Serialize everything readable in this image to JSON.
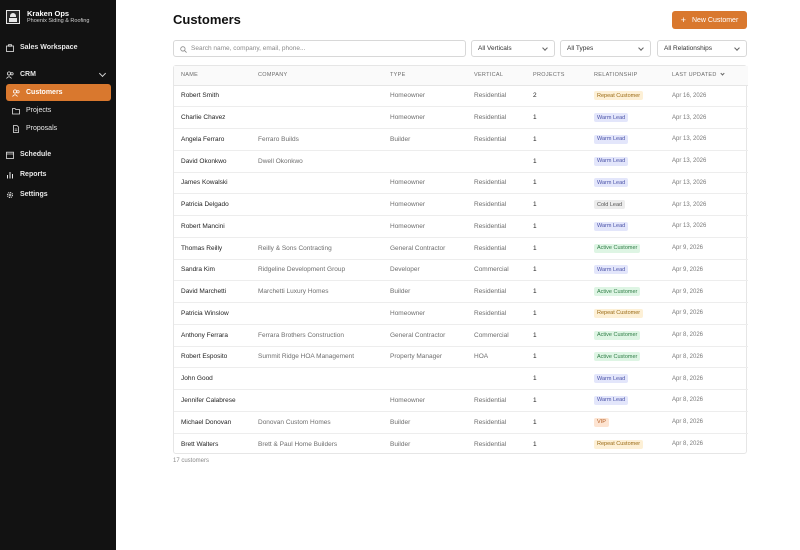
{
  "brand": {
    "title": "Kraken Ops",
    "subtitle": "Phoenix Siding & Roofing"
  },
  "sidebar": {
    "items": [
      {
        "label": "Sales Workspace",
        "icon": "briefcase-icon"
      },
      {
        "label": "CRM",
        "icon": "users-icon"
      },
      {
        "label": "Customers",
        "icon": "users-icon",
        "active": true
      },
      {
        "label": "Projects",
        "icon": "folder-icon"
      },
      {
        "label": "Proposals",
        "icon": "document-icon"
      },
      {
        "label": "Schedule",
        "icon": "calendar-icon"
      },
      {
        "label": "Reports",
        "icon": "bar-chart-icon"
      },
      {
        "label": "Settings",
        "icon": "gear-icon"
      }
    ]
  },
  "header": {
    "title": "Customers",
    "new_button": "New Customer"
  },
  "filters": {
    "search_placeholder": "Search name, company, email, phone...",
    "verticals": "All Verticals",
    "types": "All Types",
    "relationships": "All Relationships"
  },
  "table": {
    "columns": [
      "NAME",
      "COMPANY",
      "TYPE",
      "VERTICAL",
      "PROJECTS",
      "RELATIONSHIP",
      "LAST UPDATED"
    ],
    "rows": [
      {
        "name": "Robert Smith",
        "company": "",
        "type": "Homeowner",
        "vertical": "Residential",
        "projects": "2",
        "relationship": "Repeat Customer",
        "updated": "Apr 16, 2026"
      },
      {
        "name": "Charlie Chavez",
        "company": "",
        "type": "Homeowner",
        "vertical": "Residential",
        "projects": "1",
        "relationship": "Warm Lead",
        "updated": "Apr 13, 2026"
      },
      {
        "name": "Angela Ferraro",
        "company": "Ferraro Builds",
        "type": "Builder",
        "vertical": "Residential",
        "projects": "1",
        "relationship": "Warm Lead",
        "updated": "Apr 13, 2026"
      },
      {
        "name": "David Okonkwo",
        "company": "Dwell Okonkwo",
        "type": "",
        "vertical": "",
        "projects": "1",
        "relationship": "Warm Lead",
        "updated": "Apr 13, 2026"
      },
      {
        "name": "James Kowalski",
        "company": "",
        "type": "Homeowner",
        "vertical": "Residential",
        "projects": "1",
        "relationship": "Warm Lead",
        "updated": "Apr 13, 2026"
      },
      {
        "name": "Patricia Delgado",
        "company": "",
        "type": "Homeowner",
        "vertical": "Residential",
        "projects": "1",
        "relationship": "Cold Lead",
        "updated": "Apr 13, 2026"
      },
      {
        "name": "Robert Mancini",
        "company": "",
        "type": "Homeowner",
        "vertical": "Residential",
        "projects": "1",
        "relationship": "Warm Lead",
        "updated": "Apr 13, 2026"
      },
      {
        "name": "Thomas Reilly",
        "company": "Reilly & Sons Contracting",
        "type": "General Contractor",
        "vertical": "Residential",
        "projects": "1",
        "relationship": "Active Customer",
        "updated": "Apr 9, 2026"
      },
      {
        "name": "Sandra Kim",
        "company": "Ridgeline Development Group",
        "type": "Developer",
        "vertical": "Commercial",
        "projects": "1",
        "relationship": "Warm Lead",
        "updated": "Apr 9, 2026"
      },
      {
        "name": "David Marchetti",
        "company": "Marchetti Luxury Homes",
        "type": "Builder",
        "vertical": "Residential",
        "projects": "1",
        "relationship": "Active Customer",
        "updated": "Apr 9, 2026"
      },
      {
        "name": "Patricia Winslow",
        "company": "",
        "type": "Homeowner",
        "vertical": "Residential",
        "projects": "1",
        "relationship": "Repeat Customer",
        "updated": "Apr 9, 2026"
      },
      {
        "name": "Anthony Ferrara",
        "company": "Ferrara Brothers Construction",
        "type": "General Contractor",
        "vertical": "Commercial",
        "projects": "1",
        "relationship": "Active Customer",
        "updated": "Apr 8, 2026"
      },
      {
        "name": "Robert Esposito",
        "company": "Summit Ridge HOA Management",
        "type": "Property Manager",
        "vertical": "HOA",
        "projects": "1",
        "relationship": "Active Customer",
        "updated": "Apr 8, 2026"
      },
      {
        "name": "John Good",
        "company": "",
        "type": "",
        "vertical": "",
        "projects": "1",
        "relationship": "Warm Lead",
        "updated": "Apr 8, 2026"
      },
      {
        "name": "Jennifer Calabrese",
        "company": "",
        "type": "Homeowner",
        "vertical": "Residential",
        "projects": "1",
        "relationship": "Warm Lead",
        "updated": "Apr 8, 2026"
      },
      {
        "name": "Michael Donovan",
        "company": "Donovan Custom Homes",
        "type": "Builder",
        "vertical": "Residential",
        "projects": "1",
        "relationship": "VIP",
        "updated": "Apr 8, 2026"
      },
      {
        "name": "Brett Walters",
        "company": "Brett & Paul Home Builders",
        "type": "Builder",
        "vertical": "Residential",
        "projects": "1",
        "relationship": "Repeat Customer",
        "updated": "Apr 8, 2026"
      }
    ]
  },
  "badge_colors": {
    "Repeat Customer": {
      "bg": "#fdf0d6",
      "fg": "#9a6a14"
    },
    "Warm Lead": {
      "bg": "#e3e6fb",
      "fg": "#4b53a8"
    },
    "Cold Lead": {
      "bg": "#ececec",
      "fg": "#555555"
    },
    "Active Customer": {
      "bg": "#def5e4",
      "fg": "#2f7d46"
    },
    "VIP": {
      "bg": "#fde4d2",
      "fg": "#b25a1e"
    }
  },
  "footer": {
    "count": "17 customers"
  },
  "colors": {
    "accent": "#d9782e",
    "sidebar": "#121212"
  }
}
